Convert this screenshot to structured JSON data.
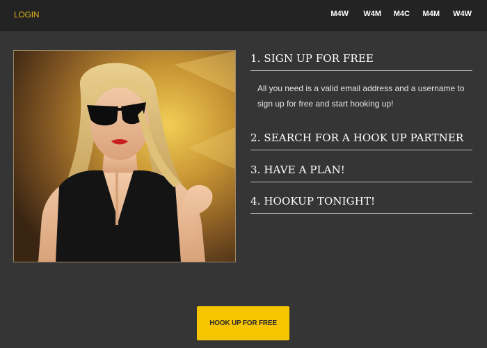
{
  "header": {
    "login_label": "LOGIN",
    "nav_items": [
      "M4W",
      "W4M",
      "M4C",
      "M4M",
      "W4W"
    ]
  },
  "hero_image": {
    "subject": "woman-with-sunglasses"
  },
  "steps": [
    {
      "title": "1. SIGN UP FOR FREE",
      "description": "All you need is a valid email address and a username to sign up for free and start hooking up!"
    },
    {
      "title": "2. SEARCH FOR A HOOK UP PARTNER"
    },
    {
      "title": "3. HAVE A PLAN!"
    },
    {
      "title": "4. HOOKUP TONIGHT!"
    }
  ],
  "cta": {
    "label": "HOOK UP FOR FREE"
  },
  "colors": {
    "background": "#353535",
    "topbar": "#232323",
    "accent": "#f7c500",
    "login": "#e2b21a"
  }
}
